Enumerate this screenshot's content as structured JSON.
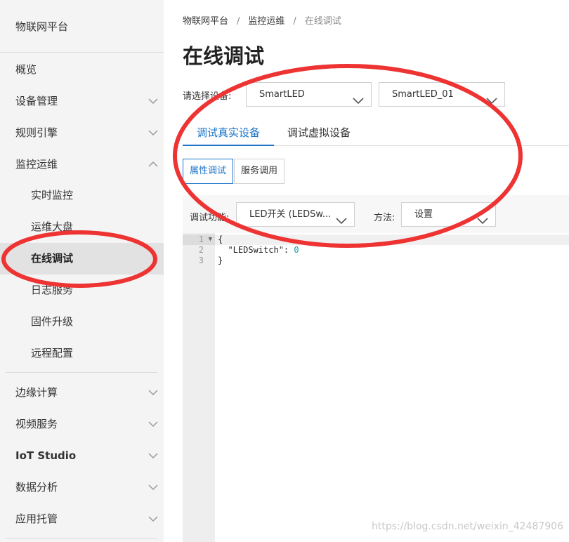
{
  "sidebar": {
    "title": "物联网平台",
    "items": [
      {
        "label": "概览"
      },
      {
        "label": "设备管理"
      },
      {
        "label": "规则引擎"
      },
      {
        "label": "监控运维"
      },
      {
        "label": "实时监控"
      },
      {
        "label": "运维大盘"
      },
      {
        "label": "在线调试"
      },
      {
        "label": "日志服务"
      },
      {
        "label": "固件升级"
      },
      {
        "label": "远程配置"
      },
      {
        "label": "边缘计算"
      },
      {
        "label": "视频服务"
      },
      {
        "label": "IoT Studio"
      },
      {
        "label": "数据分析"
      },
      {
        "label": "应用托管"
      }
    ]
  },
  "breadcrumb": [
    "物联网平台",
    "监控运维",
    "在线调试"
  ],
  "breadcrumb_sep": "/",
  "page_title": "在线调试",
  "device_select": {
    "label": "请选择设备:",
    "product": "SmartLED",
    "device": "SmartLED_01"
  },
  "tabs": [
    "调试真实设备",
    "调试虚拟设备"
  ],
  "subtabs": [
    "属性调试",
    "服务调用"
  ],
  "debug": {
    "function_label": "调试功能:",
    "function_value": "LED开关 (LEDSw...",
    "method_label": "方法:",
    "method_value": "设置"
  },
  "editor": {
    "line_numbers": [
      "1",
      "2",
      "3"
    ],
    "lines": [
      "{",
      "  \"LEDSwitch\": ",
      "}"
    ],
    "value": "0"
  },
  "watermark": "https://blog.csdn.net/weixin_42487906",
  "colors": {
    "accent": "#1a73c9",
    "annotation": "#ee3333",
    "sidebar_bg": "#f4f4f4"
  }
}
